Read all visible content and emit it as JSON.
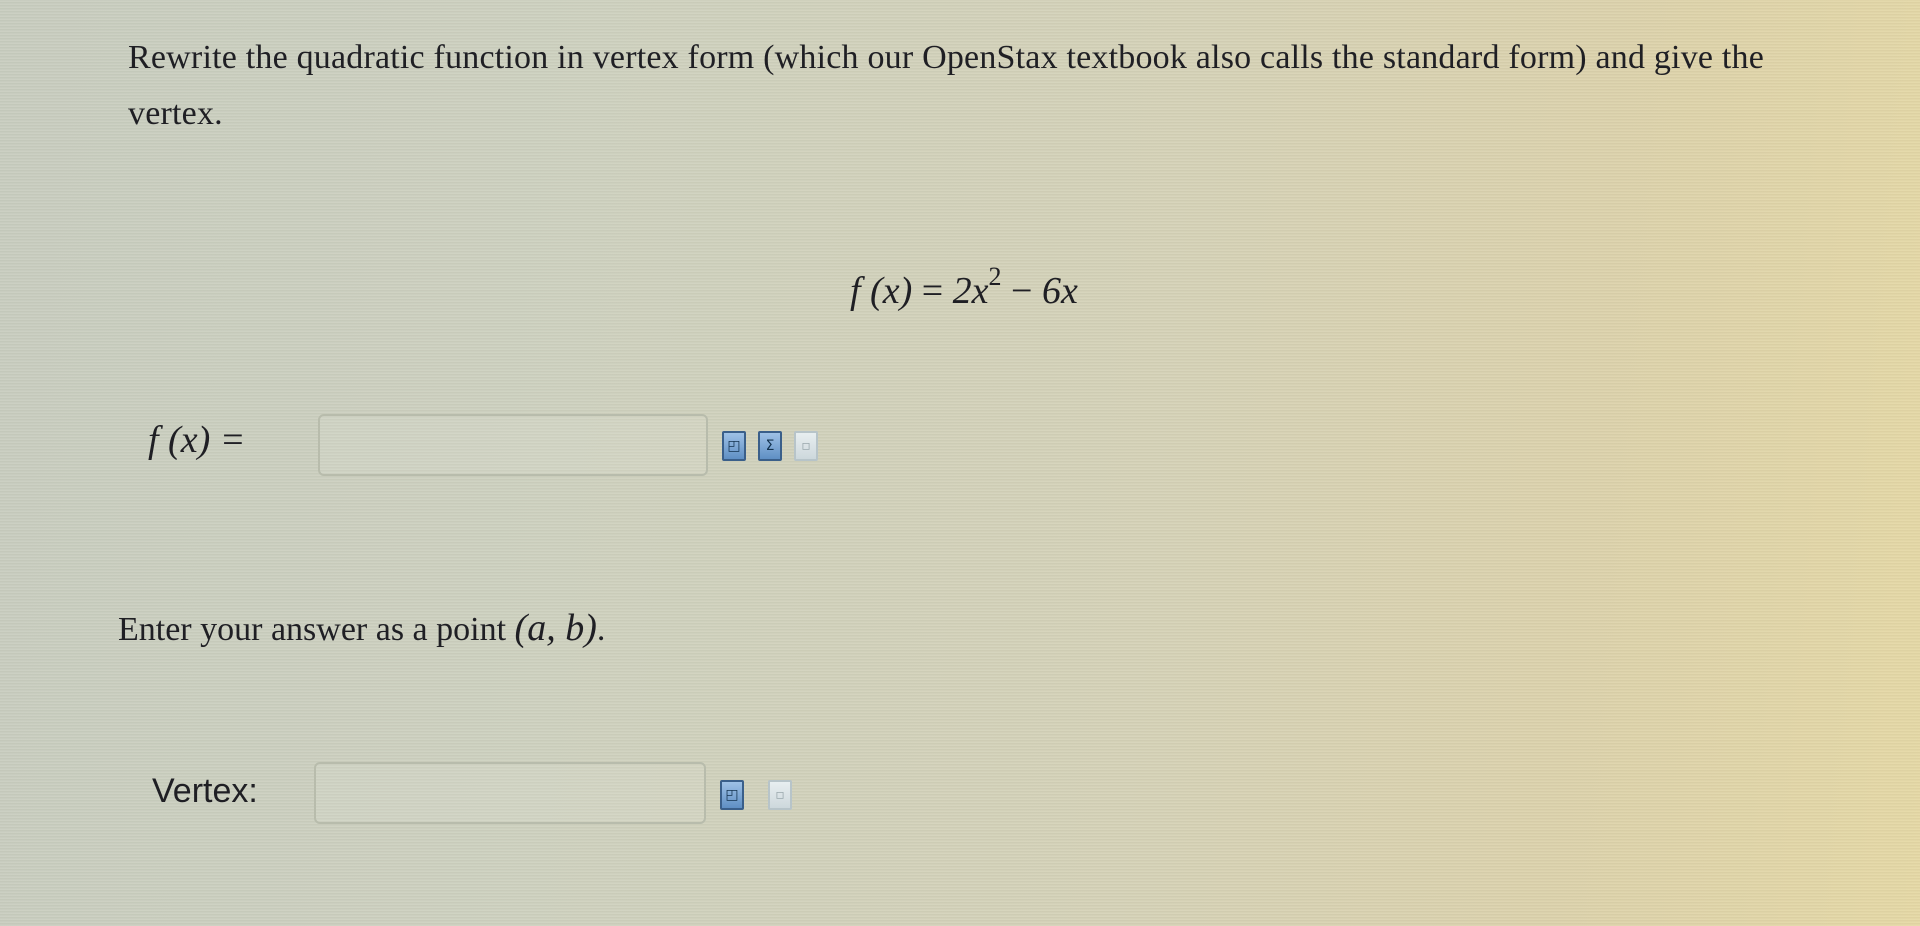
{
  "question": {
    "prompt": "Rewrite the quadratic function in vertex form (which our OpenStax textbook also calls the standard form) and give the vertex."
  },
  "equation": {
    "lhs": "f (x)",
    "equals": "=",
    "term1": "2x",
    "exponent": "2",
    "operator": "−",
    "term2": "6x"
  },
  "function_answer": {
    "label": "f (x) =",
    "value": "",
    "placeholder": ""
  },
  "instruction": {
    "text": "Enter your answer as a point ",
    "point": "(a, b)",
    "period": "."
  },
  "vertex_answer": {
    "label": "Vertex:",
    "value": "",
    "placeholder": ""
  },
  "tools": {
    "preview_icon": "preview-icon",
    "equation_editor_icon": "sigma-icon",
    "help_icon": "help-icon"
  },
  "colors": {
    "icon_active": "#5f8fc4",
    "icon_faded": "#cdd8dc",
    "input_border": "#b8bcac"
  }
}
